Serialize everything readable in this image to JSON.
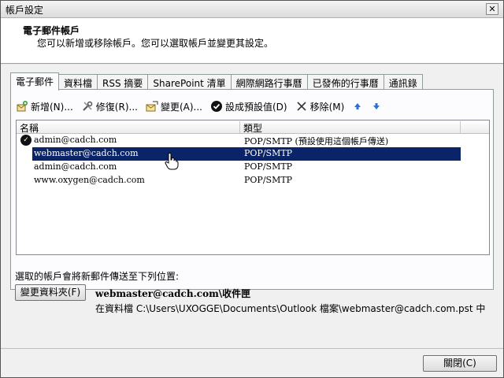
{
  "window": {
    "title": "帳戶設定",
    "close_glyph": "✕"
  },
  "header": {
    "title": "電子郵件帳戶",
    "description": "您可以新增或移除帳戶。您可以選取帳戶並變更其設定。"
  },
  "tabs": [
    {
      "label": "電子郵件",
      "active": true
    },
    {
      "label": "資料檔"
    },
    {
      "label": "RSS 摘要"
    },
    {
      "label": "SharePoint 清單"
    },
    {
      "label": "網際網路行事曆"
    },
    {
      "label": "已發佈的行事曆"
    },
    {
      "label": "通訊錄"
    }
  ],
  "toolbar": {
    "new_label": "新增(N)...",
    "repair_label": "修復(R)...",
    "change_label": "變更(A)...",
    "default_label": "設成預設值(D)",
    "remove_label": "移除(M)",
    "up_icon": "arrow-up-icon",
    "down_icon": "arrow-down-icon"
  },
  "list": {
    "col_name": "名稱",
    "col_type": "類型",
    "rows": [
      {
        "name": "admin@cadch.com",
        "type": "POP/SMTP (預設使用這個帳戶傳送)",
        "default": true
      },
      {
        "name": "webmaster@cadch.com",
        "type": "POP/SMTP",
        "selected": true
      },
      {
        "name": "admin@cadch.com",
        "type": "POP/SMTP"
      },
      {
        "name": "www.oxygen@cadch.com",
        "type": "POP/SMTP"
      }
    ]
  },
  "delivery": {
    "label": "選取的帳戶會將新郵件傳送至下列位置:",
    "change_folder_button": "變更資料夾(F)",
    "folder": "webmaster@cadch.com\\收件匣",
    "path": "在資料檔 C:\\Users\\UXOGGE\\Documents\\Outlook 檔案\\webmaster@cadch.com.pst 中"
  },
  "footer": {
    "close_button": "關閉(C)"
  },
  "colors": {
    "selection": "#0a246a",
    "arrow": "#2e6fd6"
  }
}
